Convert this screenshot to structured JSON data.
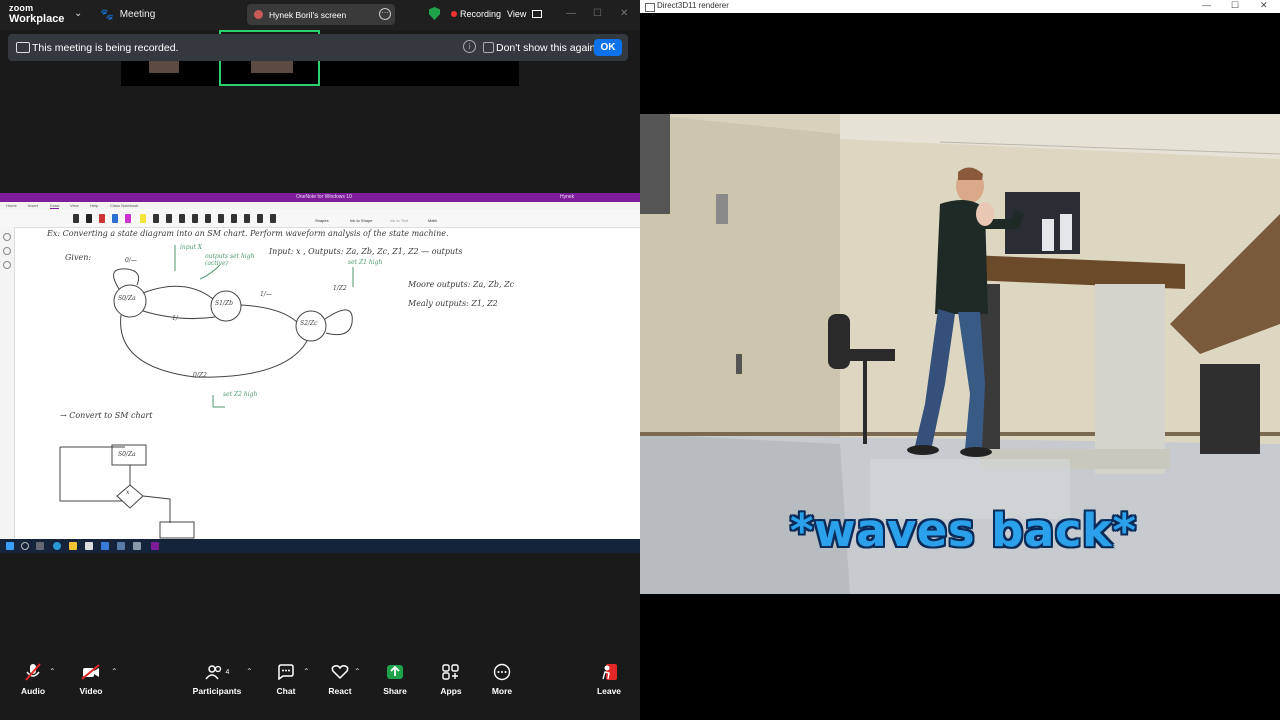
{
  "zoom": {
    "logo_line1": "zoom",
    "logo_line2": "Workplace",
    "meeting_label": "Meeting",
    "share_label": "Hynek Boril's screen",
    "recording_label": "Recording",
    "view_label": "View",
    "banner": {
      "text": "This meeting is being recorded.",
      "dont_show": "Don't show this again",
      "ok": "OK"
    },
    "toolbar": {
      "audio": "Audio",
      "video": "Video",
      "participants": "Participants",
      "participant_count": "4",
      "chat": "Chat",
      "react": "React",
      "share": "Share",
      "apps": "Apps",
      "more": "More",
      "leave": "Leave"
    },
    "colors": {
      "share_green": "#1fa34a",
      "ok_blue": "#0e72ed",
      "speaker_green": "#2bd16e",
      "leave_red": "#e02828"
    }
  },
  "onenote": {
    "app_title": "OneNote for Windows 10",
    "user": "Hynek",
    "menu": [
      "Home",
      "Insert",
      "Draw",
      "View",
      "Help",
      "Class Notebook"
    ],
    "ribbon_items": [
      "Shapes",
      "Ink to Shape",
      "Ink to Text",
      "Math"
    ],
    "page_header": "Ex: Converting a state diagram into an SM chart. Perform waveform analysis of the state machine.",
    "ink": {
      "given": "Given:",
      "inputs": "Input: x , Outputs: Za, Zb, Zc, Z1, Z2 — outputs",
      "moore": "Moore outputs: Za, Zb, Zc",
      "mealy": "Mealy outputs: Z1, Z2",
      "input_x": "input X",
      "outputs_set_high": "outputs set high (active)",
      "set_z1_high": "set Z1 high",
      "set_z2_high": "set Z2 high",
      "convert": "→ Convert to SM chart",
      "s0": "S0/Za",
      "s1": "S1/Zb",
      "s2": "S2/Zc",
      "t_0": "0/—",
      "t_1": "1/—",
      "t_1z2": "1/Z2",
      "t_0z2": "0/Z2",
      "t_1b": "1/—",
      "dec_x": "x"
    }
  },
  "renderer": {
    "window_title": "Direct3D11 renderer",
    "caption": "*waves back*"
  }
}
